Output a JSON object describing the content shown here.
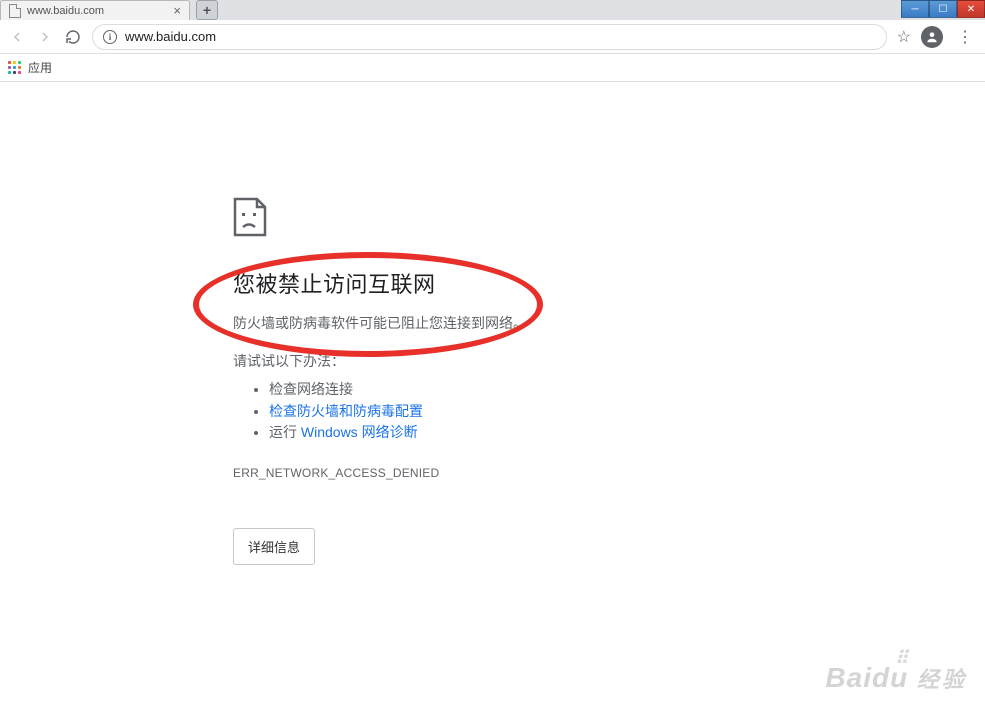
{
  "tab": {
    "title": "www.baidu.com"
  },
  "omnibox": {
    "url": "www.baidu.com"
  },
  "bookmarks": {
    "apps_label": "应用"
  },
  "error": {
    "heading": "您被禁止访问互联网",
    "subtext": "防火墙或防病毒软件可能已阻止您连接到网络。",
    "try_label": "请试试以下办法：",
    "suggestion1": "检查网络连接",
    "suggestion2": "检查防火墙和防病毒配置",
    "suggestion3_prefix": "运行 ",
    "suggestion3_link": "Windows 网络诊断",
    "code": "ERR_NETWORK_ACCESS_DENIED",
    "details_button": "详细信息"
  },
  "watermark": {
    "brand": "Baidu",
    "text": "经验"
  }
}
